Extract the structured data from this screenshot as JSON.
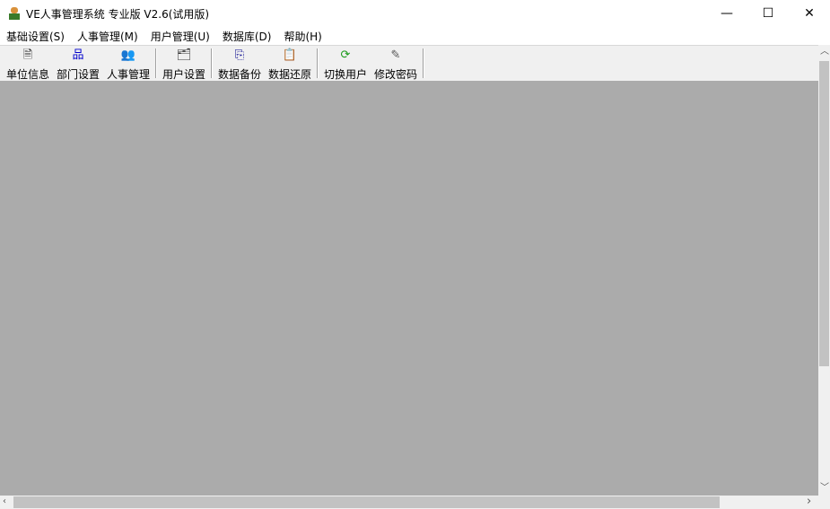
{
  "window": {
    "title": "VE人事管理系统 专业版 V2.6(试用版)",
    "minimize": "—",
    "maximize": "☐",
    "close": "✕"
  },
  "menubar": [
    "基础设置(S)",
    "人事管理(M)",
    "用户管理(U)",
    "数据库(D)",
    "帮助(H)"
  ],
  "toolbar": [
    {
      "label": "单位信息",
      "icon": "document-star-icon",
      "glyph": "🗎",
      "color": "#222"
    },
    {
      "label": "部门设置",
      "icon": "org-chart-icon",
      "glyph": "品",
      "color": "#0000cc"
    },
    {
      "label": "人事管理",
      "icon": "people-icon",
      "glyph": "👥",
      "color": "#7a4a1a"
    },
    {
      "label": "用户设置",
      "icon": "user-settings-icon",
      "glyph": "🗂",
      "color": "#333"
    },
    {
      "label": "数据备份",
      "icon": "copy-icon",
      "glyph": "⎘",
      "color": "#00008b"
    },
    {
      "label": "数据还原",
      "icon": "clipboard-icon",
      "glyph": "📋",
      "color": "#333"
    },
    {
      "label": "切换用户",
      "icon": "refresh-icon",
      "glyph": "⟳",
      "color": "#1a9a1a"
    },
    {
      "label": "修改密码",
      "icon": "edit-document-icon",
      "glyph": "✎",
      "color": "#555"
    }
  ]
}
